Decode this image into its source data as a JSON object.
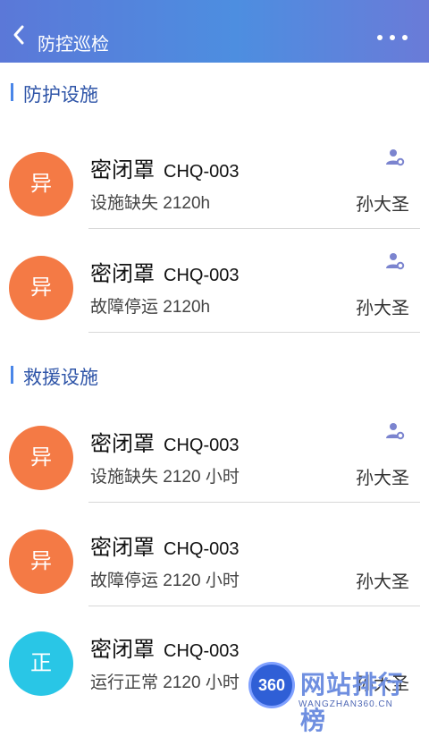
{
  "header": {
    "title": "防控巡检",
    "back_icon": "chevron-left-icon",
    "more_icon": "more-horizontal-icon"
  },
  "sections": [
    {
      "title": "防护设施",
      "items": [
        {
          "badge": "异",
          "badge_color": "#f47a45",
          "name": "密闭罩",
          "code": "CHQ-003",
          "status": "设施缺失 2120h",
          "person": "孙大圣",
          "show_user_icon": true
        },
        {
          "badge": "异",
          "badge_color": "#f47a45",
          "name": "密闭罩",
          "code": "CHQ-003",
          "status": "故障停运 2120h",
          "person": "孙大圣",
          "show_user_icon": true
        }
      ]
    },
    {
      "title": "救援设施",
      "items": [
        {
          "badge": "异",
          "badge_color": "#f47a45",
          "name": "密闭罩",
          "code": "CHQ-003",
          "status": "设施缺失 2120 小时",
          "person": "孙大圣",
          "show_user_icon": true
        },
        {
          "badge": "异",
          "badge_color": "#f47a45",
          "name": "密闭罩",
          "code": "CHQ-003",
          "status": "故障停运 2120 小时",
          "person": "孙大圣",
          "show_user_icon": false
        },
        {
          "badge": "正",
          "badge_color": "#29c6e6",
          "name": "密闭罩",
          "code": "CHQ-003",
          "status": "运行正常 2120 小时",
          "person": "孙大圣",
          "show_user_icon": false
        }
      ]
    }
  ],
  "watermark": {
    "badge": "360",
    "title": "网站排行榜",
    "subtitle": "WANGZHAN360.CN"
  },
  "colors": {
    "header_start": "#5b78d8",
    "header_end": "#6a7bd8",
    "section_title": "#2f55a8",
    "abnormal": "#f47a45",
    "normal": "#29c6e6"
  }
}
